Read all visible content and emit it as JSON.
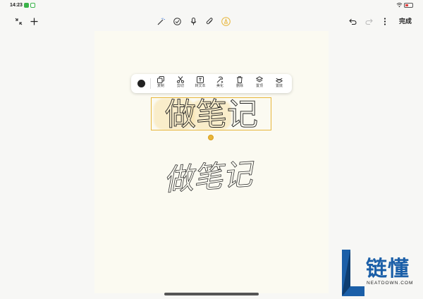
{
  "status": {
    "time": "14:23"
  },
  "toolbar": {
    "done_label": "完成"
  },
  "selection_menu": {
    "items": [
      {
        "label": "复制",
        "icon": "copy-icon"
      },
      {
        "label": "剪切",
        "icon": "scissors-icon"
      },
      {
        "label": "转文本",
        "icon": "text-convert-icon"
      },
      {
        "label": "美化",
        "icon": "beautify-icon"
      },
      {
        "label": "删除",
        "icon": "trash-icon"
      },
      {
        "label": "置顶",
        "icon": "bring-to-front-icon"
      },
      {
        "label": "置底",
        "icon": "send-to-back-icon"
      }
    ]
  },
  "note": {
    "printed_text": "做笔记",
    "handwritten_text": "做笔记"
  },
  "watermark": {
    "chinese": "链懂",
    "english": "NEATDOWN.COM"
  },
  "colors": {
    "accent": "#e7b63b",
    "page": "#fbfaf1",
    "logo_blue": "#1b5fa8"
  }
}
